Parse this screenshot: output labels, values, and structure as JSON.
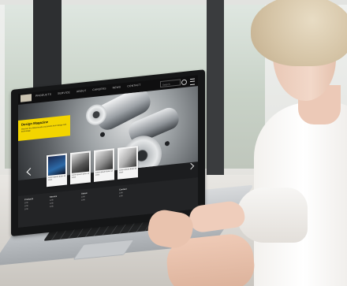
{
  "header": {
    "nav_items": [
      "PRODUCTS",
      "SERVICE",
      "ABOUT",
      "CAREERS",
      "NEWS",
      "CONTACT"
    ],
    "search_placeholder": "Search"
  },
  "hero": {
    "title": "Design Magazine",
    "text": "Discover the latest trends and stories from design and technology."
  },
  "cards": [
    {
      "caption": "Lorem ipsum dolor sit amet"
    },
    {
      "caption": "Lorem ipsum dolor sit amet"
    },
    {
      "caption": "Lorem ipsum dolor sit amet"
    },
    {
      "caption": "Lorem ipsum dolor sit amet"
    }
  ],
  "footer": {
    "columns": [
      {
        "title": "Products",
        "links": [
          "Link",
          "Link",
          "Link"
        ]
      },
      {
        "title": "Service",
        "links": [
          "Link",
          "Link",
          "Link"
        ]
      },
      {
        "title": "About",
        "links": [
          "Link",
          "Link"
        ]
      },
      {
        "title": "Contact",
        "links": [
          "Link",
          "Link"
        ]
      }
    ]
  },
  "colors": {
    "accent": "#f3d500",
    "dark": "#151617"
  },
  "icons": [
    "search-icon",
    "menu-icon",
    "arrow-left-icon",
    "arrow-right-icon"
  ]
}
